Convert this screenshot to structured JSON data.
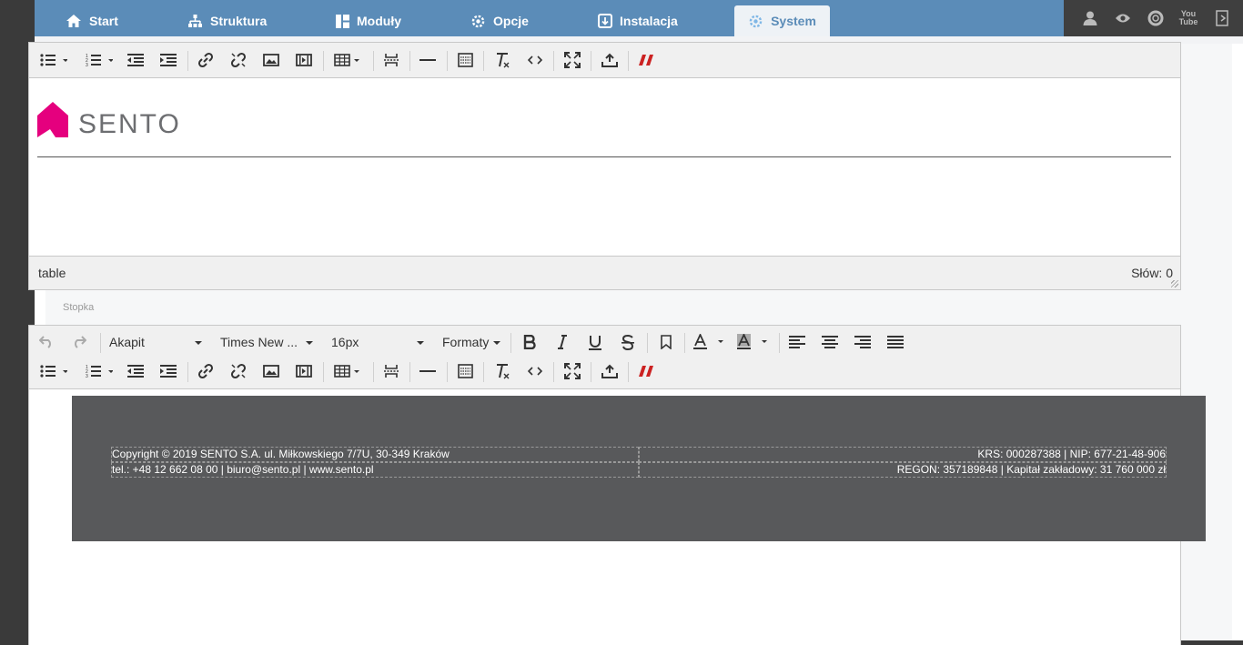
{
  "nav": {
    "tabs": [
      {
        "label": "Start",
        "icon": "home-icon"
      },
      {
        "label": "Struktura",
        "icon": "sitemap-icon"
      },
      {
        "label": "Moduły",
        "icon": "modules-icon"
      },
      {
        "label": "Opcje",
        "icon": "gear-icon"
      },
      {
        "label": "Instalacja",
        "icon": "install-icon"
      },
      {
        "label": "System",
        "icon": "gear-icon"
      }
    ],
    "active_tab": "System",
    "right_icons": [
      "user-icon",
      "eye-icon",
      "lifebuoy-icon",
      "youtube-icon",
      "logout-icon"
    ],
    "right_icons_text": {
      "youtube_top": "You",
      "youtube_bottom": "Tube"
    }
  },
  "header_editor": {
    "logo_text": "SENTO",
    "status_path": "table",
    "word_count": "Słów: 0"
  },
  "footer_editor": {
    "section_label": "Stopka",
    "block_format": "Akapit",
    "font_family": "Times New ...",
    "font_size": "16px",
    "formats_label": "Formaty",
    "rows": [
      {
        "left": "Copyright © 2019 SENTO S.A. ul. Miłkowskiego 7/7U, 30-349 Kraków",
        "right": "KRS: 000287388 | NIP: 677-21-48-906"
      },
      {
        "left": "tel.: +48 12 662 08 00 | biuro@sento.pl | www.sento.pl",
        "right": "REGON: 357189848 | Kapitał zakładowy: 31 760 000 zł"
      }
    ]
  },
  "colors": {
    "nav_bg": "#5b8cb8",
    "accent_red": "#cc2222",
    "logo_magenta": "#e5007e",
    "footer_bg": "#58595b"
  }
}
